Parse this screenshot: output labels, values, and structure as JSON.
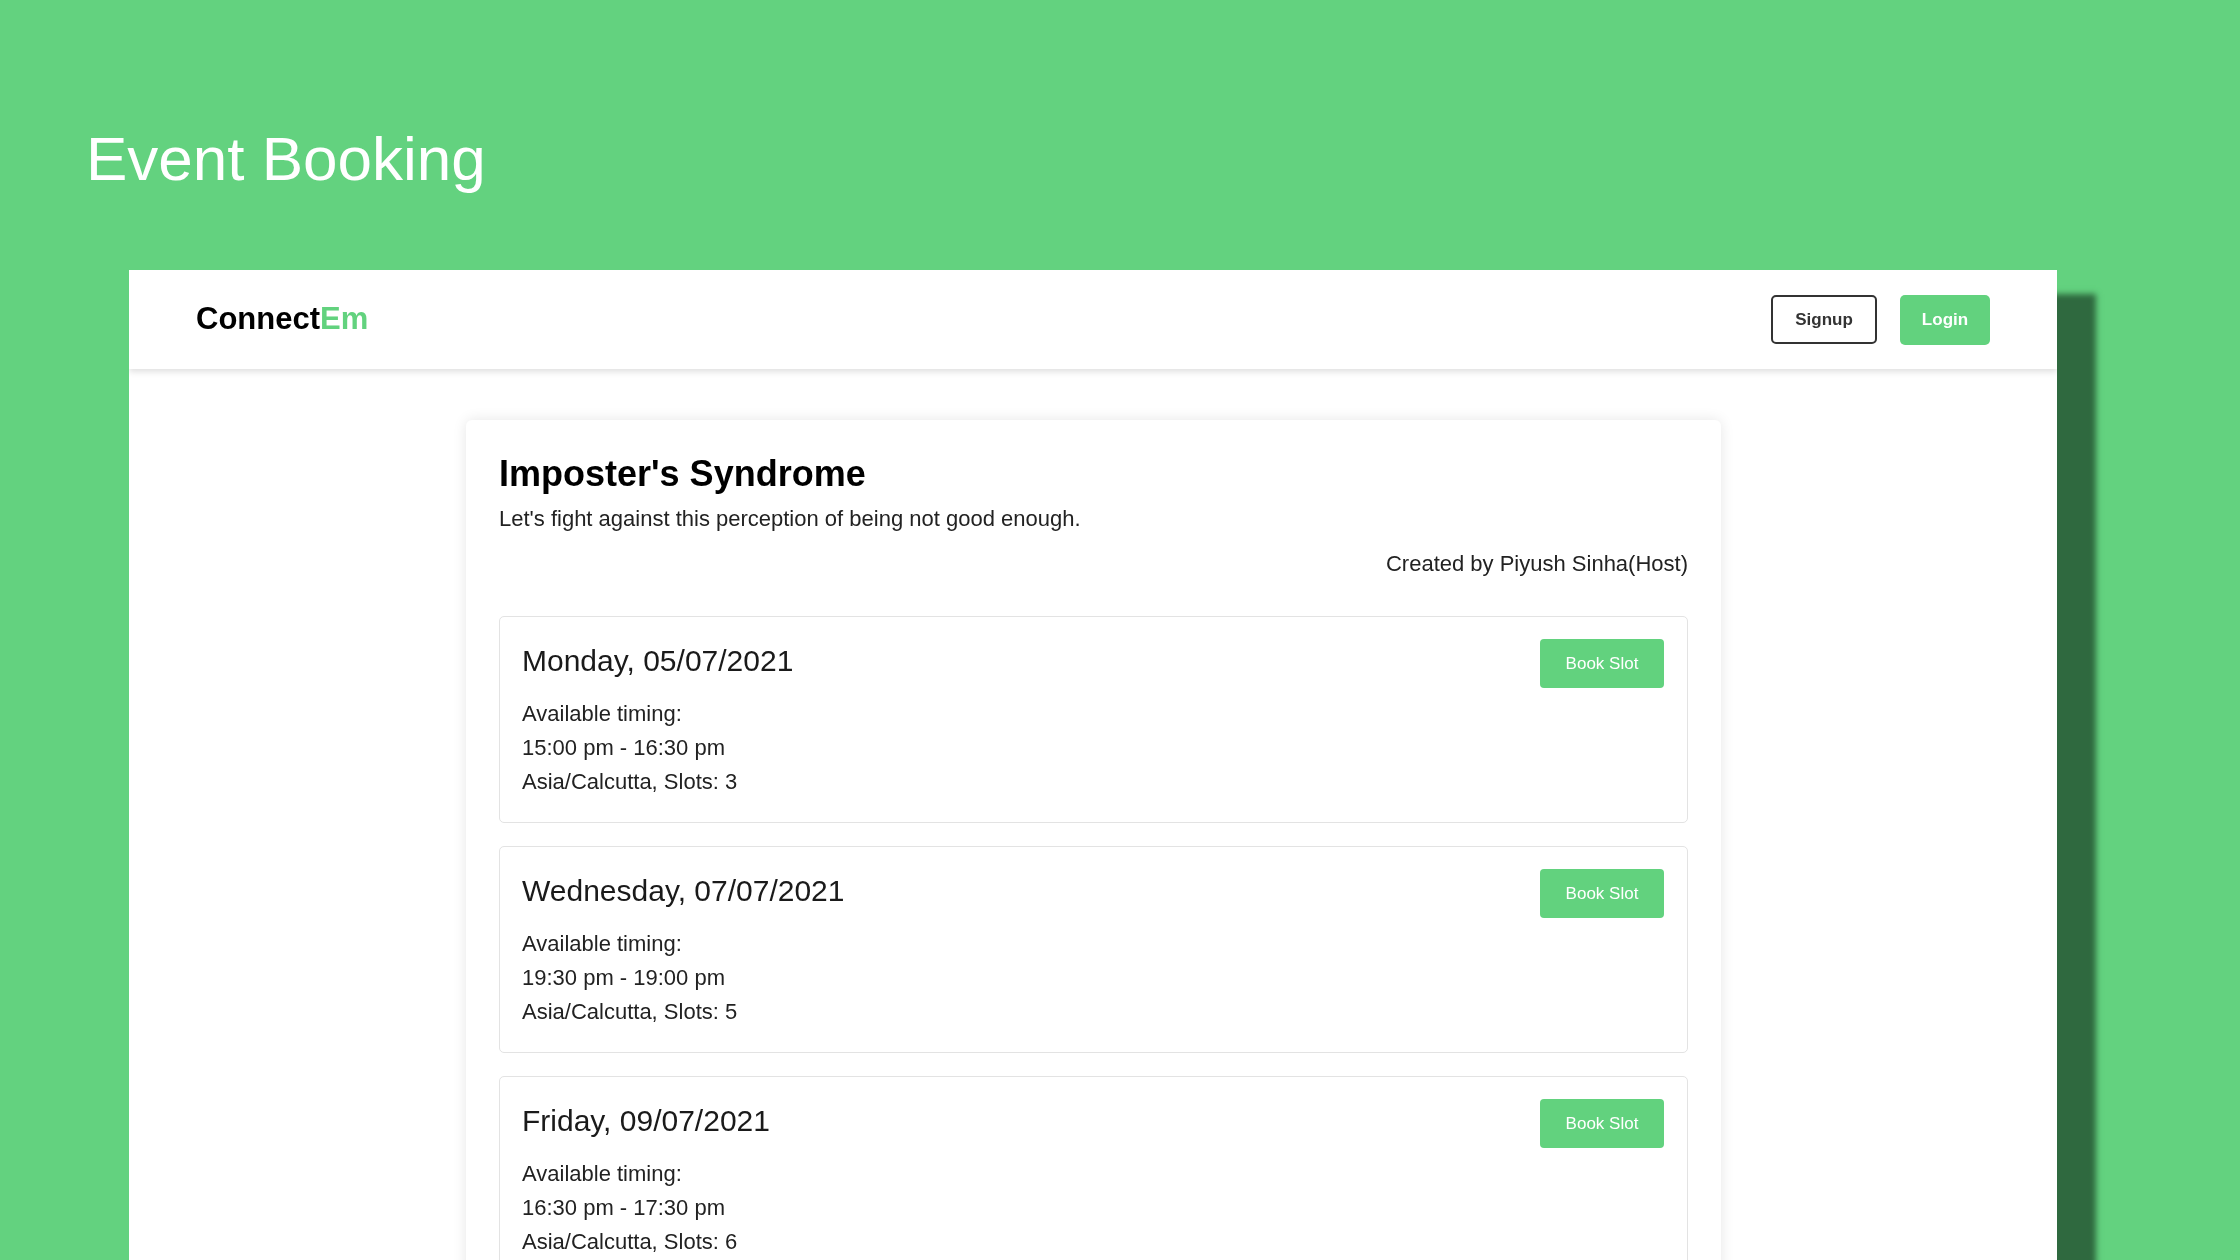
{
  "slide_title": "Event Booking",
  "navbar": {
    "logo": {
      "text": "Connect",
      "accent": "Em"
    },
    "buttons": [
      {
        "label": "Signup",
        "kind": "outline"
      },
      {
        "label": "Login",
        "kind": "filled"
      }
    ]
  },
  "event": {
    "title": "Imposter's Syndrome",
    "description": "Let's fight against this perception of being not good enough.",
    "created_by": "Created by Piyush Sinha(Host)",
    "slots": [
      {
        "date": "Monday, 05/07/2021",
        "timing_label": "Available timing:",
        "time": "15:00 pm - 16:30 pm",
        "details": "Asia/Calcutta, Slots: 3",
        "button": "Book Slot"
      },
      {
        "date": "Wednesday, 07/07/2021",
        "timing_label": "Available timing:",
        "time": "19:30 pm - 19:00 pm",
        "details": "Asia/Calcutta, Slots: 5",
        "button": "Book Slot"
      },
      {
        "date": "Friday, 09/07/2021",
        "timing_label": "Available timing:",
        "time": "16:30 pm - 17:30 pm",
        "details": "Asia/Calcutta, Slots: 6",
        "button": "Book Slot"
      }
    ]
  }
}
